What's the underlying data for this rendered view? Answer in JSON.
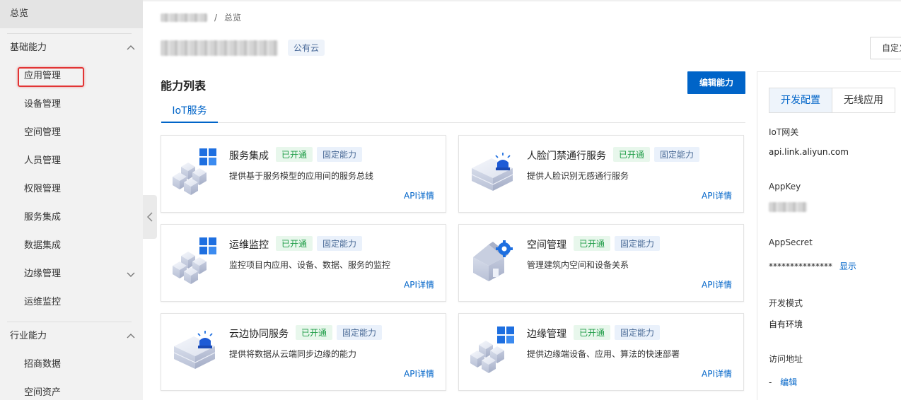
{
  "sidebar": {
    "overview": "总览",
    "section_basic": "基础能力",
    "section_industry": "行业能力",
    "items_basic": [
      "应用管理",
      "设备管理",
      "空间管理",
      "人员管理",
      "权限管理",
      "服务集成",
      "数据集成",
      "边缘管理",
      "运维监控"
    ],
    "items_industry": [
      "招商数据",
      "空间资产"
    ]
  },
  "breadcrumb": {
    "current": "总览",
    "separator": "/"
  },
  "project": {
    "tag": "公有云"
  },
  "custom_button": "自定义",
  "abilities": {
    "title": "能力列表",
    "edit_button": "编辑能力",
    "tab": "IoT服务",
    "cards": [
      {
        "title": "服务集成",
        "status": "已开通",
        "kind": "固定能力",
        "desc": "提供基于服务模型的应用间的服务总线",
        "link": "API详情",
        "icon": "blocks-grid-icon"
      },
      {
        "title": "人脸门禁通行服务",
        "status": "已开通",
        "kind": "固定能力",
        "desc": "提供人脸识别无感通行服务",
        "link": "API详情",
        "icon": "alarm-box-icon"
      },
      {
        "title": "运维监控",
        "status": "已开通",
        "kind": "固定能力",
        "desc": "监控项目内应用、设备、数据、服务的监控",
        "link": "API详情",
        "icon": "blocks-grid-icon"
      },
      {
        "title": "空间管理",
        "status": "已开通",
        "kind": "固定能力",
        "desc": "管理建筑内空间和设备关系",
        "link": "API详情",
        "icon": "house-gear-icon"
      },
      {
        "title": "云边协同服务",
        "status": "已开通",
        "kind": "固定能力",
        "desc": "提供将数据从云端同步边缘的能力",
        "link": "API详情",
        "icon": "alarm-box-icon"
      },
      {
        "title": "边缘管理",
        "status": "已开通",
        "kind": "固定能力",
        "desc": "提供边缘端设备、应用、算法的快速部署",
        "link": "API详情",
        "icon": "blocks-grid-icon"
      }
    ]
  },
  "dev_panel": {
    "tab_active": "开发配置",
    "tab_other": "无线应用",
    "gateway_label": "IoT网关",
    "gateway_value": "api.link.aliyun.com",
    "appkey_label": "AppKey",
    "appsecret_label": "AppSecret",
    "appsecret_value": "***************",
    "show_link": "显示",
    "mode_label": "开发模式",
    "mode_value": "自有环境",
    "access_label": "访问地址",
    "access_dash": "-",
    "edit_link": "编辑"
  }
}
